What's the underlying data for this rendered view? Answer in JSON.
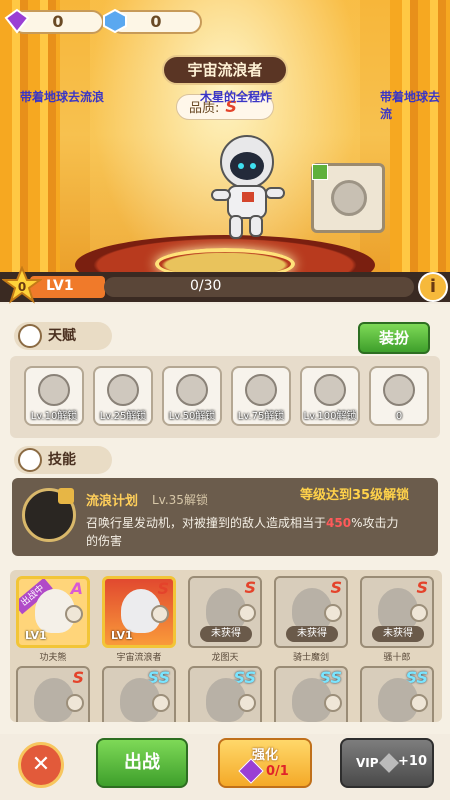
{
  "top": {
    "currency_purple": "0",
    "currency_blue": "0"
  },
  "hero": {
    "name": "宇宙流浪者",
    "side_left": "带着地球去流浪",
    "side_right": "带着地球去流",
    "subtitle": "木星的全程炸",
    "quality_label": "品质:",
    "quality_value": "S"
  },
  "level": {
    "star_count": "0",
    "level_label": "LV1",
    "xp_text": "0/30",
    "xp_fraction": 0
  },
  "talent": {
    "title": "天赋",
    "dress_button": "装扮",
    "slots": [
      {
        "label": "Lv.10解锁"
      },
      {
        "label": "Lv.25解锁"
      },
      {
        "label": "Lv.50解锁"
      },
      {
        "label": "Lv.75解锁"
      },
      {
        "label": "Lv.100解锁"
      },
      {
        "label": "0"
      }
    ]
  },
  "skill": {
    "title": "技能",
    "name": "流浪计划",
    "unlock_level": "Lv.35解锁",
    "requirement": "等级达到35级解锁",
    "desc_prefix": "召唤行星发动机，对被撞到的敌人造成相当于",
    "desc_value": "450",
    "desc_suffix": "%攻击力的伤害"
  },
  "roster": {
    "cards": [
      {
        "name": "功夫熊",
        "grade": "A",
        "status": "LV1",
        "ribbon": "出战中"
      },
      {
        "name": "宇宙流浪者",
        "grade": "S",
        "status": "LV1"
      },
      {
        "name": "龙图天",
        "grade": "S",
        "status": "未获得"
      },
      {
        "name": "骑士魔剑",
        "grade": "S",
        "status": "未获得"
      },
      {
        "name": "骚十郎",
        "grade": "S",
        "status": "未获得"
      },
      {
        "name": "",
        "grade": "S",
        "status": ""
      },
      {
        "name": "",
        "grade": "SS",
        "status": ""
      },
      {
        "name": "",
        "grade": "SS",
        "status": ""
      },
      {
        "name": "",
        "grade": "SS",
        "status": ""
      },
      {
        "name": "",
        "grade": "SS",
        "status": ""
      }
    ]
  },
  "bottom": {
    "close_symbol": "✕",
    "fight_label": "出战",
    "upgrade_label": "强化",
    "upgrade_count": "0/1",
    "vip_label": "VIP",
    "vip_count": "+10"
  }
}
